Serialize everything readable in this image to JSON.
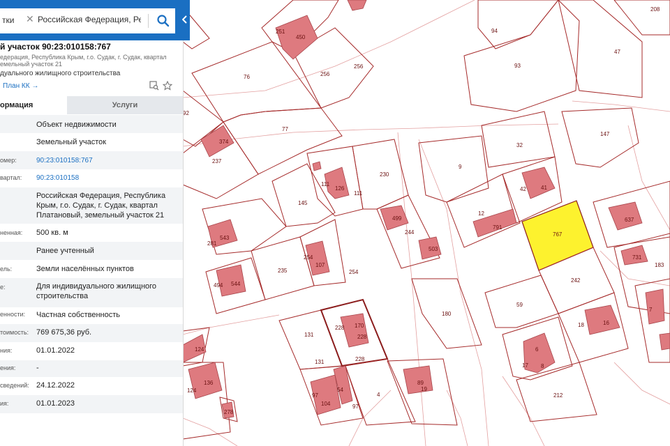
{
  "search": {
    "category": "тки",
    "value": "Российская Федерация, Республ"
  },
  "parcel": {
    "title": "й участок 90:23:010158:767",
    "address_line1": "едерация, Республика Крым, г.о. Судак, г. Судак, квартал",
    "address_line2": "емельный участок 21",
    "purpose": "дуального жилищного строительства",
    "plan_link": "План КК →"
  },
  "tabs": {
    "info": "ормация",
    "services": "Услуги"
  },
  "rows": [
    {
      "label": "",
      "value": "Объект недвижимости",
      "link": false
    },
    {
      "label": "",
      "value": "Земельный участок",
      "link": false
    },
    {
      "label": "омер:",
      "value": "90:23:010158:767",
      "link": true
    },
    {
      "label": "вартал:",
      "value": "90:23:010158",
      "link": true
    },
    {
      "label": "",
      "value": "Российская Федерация, Республика Крым, г.о. Судак, г. Судак, квартал Платановый, земельный участок 21",
      "link": false
    },
    {
      "label": "ненная:",
      "value": "500 кв. м",
      "link": false
    },
    {
      "label": "",
      "value": "Ранее учтенный",
      "link": false
    },
    {
      "label": "ель:",
      "value": "Земли населённых пунктов",
      "link": false
    },
    {
      "label": "е:",
      "value": "Для индивидуального жилищного строительства",
      "link": false
    },
    {
      "label": "енности:",
      "value": "Частная собственность",
      "link": false
    },
    {
      "label": "тоимость:",
      "value": "769 675,36 руб.",
      "link": false
    },
    {
      "label": "ния:",
      "value": "01.01.2022",
      "link": false
    },
    {
      "label": "ения:",
      "value": "-",
      "link": false
    },
    {
      "label": "сведений:",
      "value": "24.12.2022",
      "link": false
    },
    {
      "label": "ия:",
      "value": "01.01.2023",
      "link": false
    }
  ],
  "map": {
    "selected_label": "767",
    "colors": {
      "parcel": "#a52a2a",
      "building": "#de7a7f",
      "selected": "#fdf22e",
      "accent": "#1a6fc2"
    },
    "labels": [
      {
        "id": "p208",
        "text": "208"
      },
      {
        "id": "p251",
        "text": "251"
      },
      {
        "id": "p450",
        "text": "450"
      },
      {
        "id": "p94",
        "text": "94"
      },
      {
        "id": "p47",
        "text": "47"
      },
      {
        "id": "p93",
        "text": "93"
      },
      {
        "id": "p76",
        "text": "76"
      },
      {
        "id": "p256a",
        "text": "256"
      },
      {
        "id": "p256b",
        "text": "256"
      },
      {
        "id": "p92",
        "text": "92"
      },
      {
        "id": "p77",
        "text": "77"
      },
      {
        "id": "p147",
        "text": "147"
      },
      {
        "id": "p32",
        "text": "32"
      },
      {
        "id": "p374",
        "text": "374"
      },
      {
        "id": "p237",
        "text": "237"
      },
      {
        "id": "p9",
        "text": "9"
      },
      {
        "id": "p230",
        "text": "230"
      },
      {
        "id": "p111a",
        "text": "111"
      },
      {
        "id": "p126",
        "text": "126"
      },
      {
        "id": "p111b",
        "text": "111"
      },
      {
        "id": "p42",
        "text": "42"
      },
      {
        "id": "p41",
        "text": "41"
      },
      {
        "id": "p145",
        "text": "145"
      },
      {
        "id": "p499",
        "text": "499"
      },
      {
        "id": "p12",
        "text": "12"
      },
      {
        "id": "p791",
        "text": "791"
      },
      {
        "id": "p637",
        "text": "637"
      },
      {
        "id": "p281",
        "text": "281"
      },
      {
        "id": "p543",
        "text": "543"
      },
      {
        "id": "p244",
        "text": "244"
      },
      {
        "id": "p503",
        "text": "503"
      },
      {
        "id": "p254a",
        "text": "254"
      },
      {
        "id": "p107",
        "text": "107"
      },
      {
        "id": "p235",
        "text": "235"
      },
      {
        "id": "p731",
        "text": "731"
      },
      {
        "id": "p183",
        "text": "183"
      },
      {
        "id": "p254b",
        "text": "254"
      },
      {
        "id": "p242",
        "text": "242"
      },
      {
        "id": "p494",
        "text": "494"
      },
      {
        "id": "p544",
        "text": "544"
      },
      {
        "id": "p180",
        "text": "180"
      },
      {
        "id": "p59",
        "text": "59"
      },
      {
        "id": "p18",
        "text": "18"
      },
      {
        "id": "p16",
        "text": "16"
      },
      {
        "id": "p131a",
        "text": "131"
      },
      {
        "id": "p228a",
        "text": "228"
      },
      {
        "id": "p170",
        "text": "170"
      },
      {
        "id": "p228b",
        "text": "228"
      },
      {
        "id": "p124a",
        "text": "124"
      },
      {
        "id": "p6",
        "text": "6"
      },
      {
        "id": "p17",
        "text": "17"
      },
      {
        "id": "p8",
        "text": "8"
      },
      {
        "id": "p131b",
        "text": "131"
      },
      {
        "id": "p228c",
        "text": "228"
      },
      {
        "id": "p136",
        "text": "136"
      },
      {
        "id": "p124b",
        "text": "124"
      },
      {
        "id": "p97a",
        "text": "97"
      },
      {
        "id": "p104",
        "text": "104"
      },
      {
        "id": "p54",
        "text": "54"
      },
      {
        "id": "p97b",
        "text": "97"
      },
      {
        "id": "p4",
        "text": "4"
      },
      {
        "id": "p89",
        "text": "89"
      },
      {
        "id": "p19",
        "text": "19"
      },
      {
        "id": "p212",
        "text": "212"
      },
      {
        "id": "p278",
        "text": "278"
      },
      {
        "id": "p7",
        "text": "7"
      }
    ]
  }
}
